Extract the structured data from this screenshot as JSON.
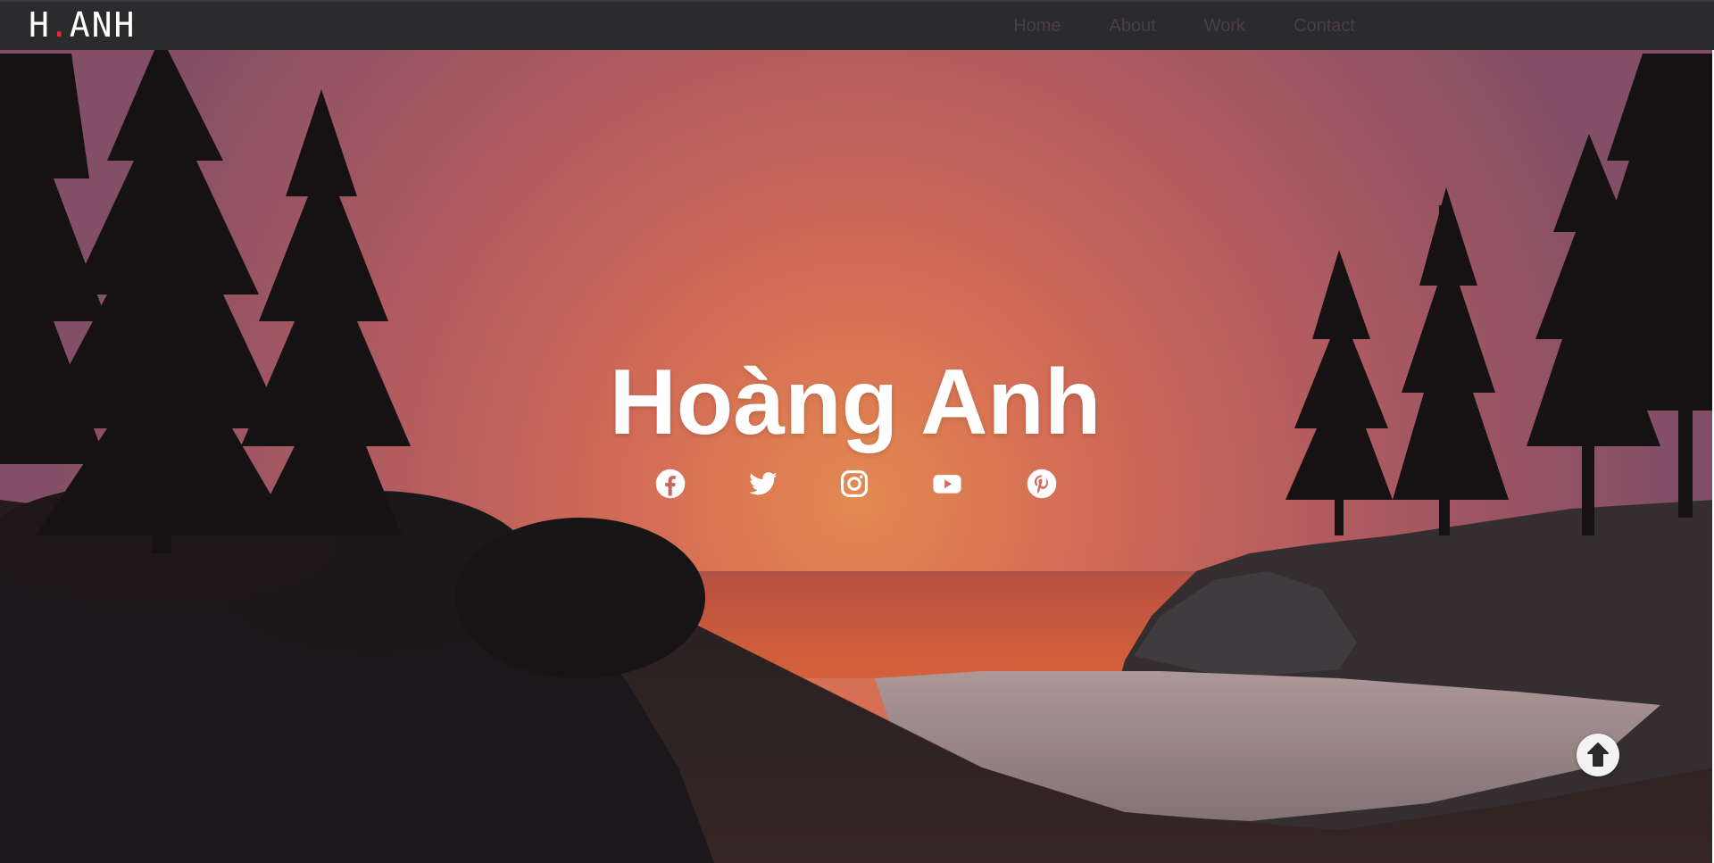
{
  "header": {
    "logo_left": "H",
    "logo_dot": ".",
    "logo_right": "ANH",
    "nav": [
      {
        "label": "Home"
      },
      {
        "label": "About"
      },
      {
        "label": "Work"
      },
      {
        "label": "Contact"
      }
    ]
  },
  "hero": {
    "title": "Hoàng Anh",
    "social": [
      {
        "icon": "facebook-icon"
      },
      {
        "icon": "twitter-icon"
      },
      {
        "icon": "instagram-icon"
      },
      {
        "icon": "youtube-icon"
      },
      {
        "icon": "pinterest-icon"
      }
    ]
  },
  "scroll_top": {
    "icon": "arrow-up-circle-icon"
  },
  "colors": {
    "topbar": "#2b2b2d",
    "nav_text": "#4b3c48",
    "logo_accent": "#e6293a",
    "sky_top": "#9b5d74",
    "sky_glow": "#f08a52"
  }
}
